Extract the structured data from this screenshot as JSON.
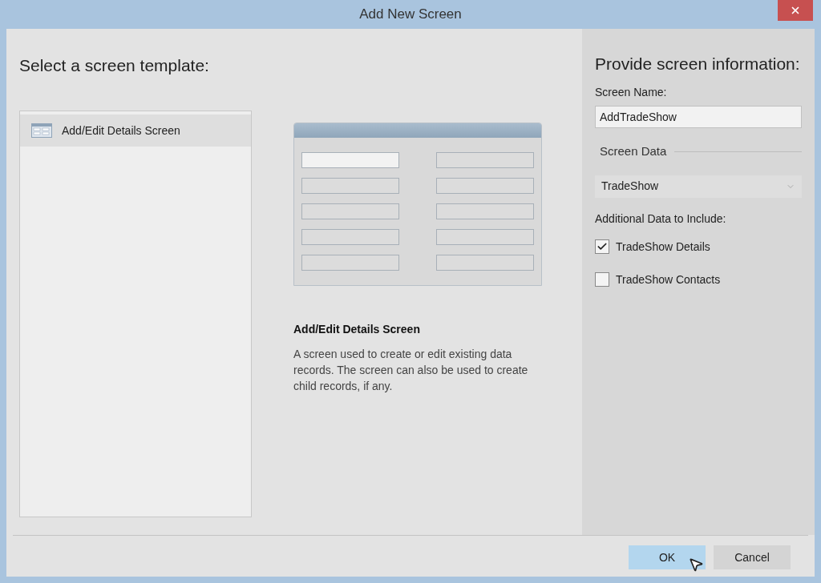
{
  "window": {
    "title": "Add New Screen"
  },
  "templates": {
    "heading": "Select a screen template:",
    "items": [
      {
        "label": "Add/Edit Details Screen",
        "selected": true
      }
    ]
  },
  "preview": {
    "title": "Add/Edit Details Screen",
    "description": "A screen used to create or edit existing data records. The screen can also be used to create child records, if any."
  },
  "info": {
    "heading": "Provide screen information:",
    "screen_name_label": "Screen Name:",
    "screen_name_value": "AddTradeShow",
    "screen_data_label": "Screen Data",
    "screen_data_value": "TradeShow",
    "additional_label": "Additional Data to Include:",
    "options": [
      {
        "label": "TradeShow Details",
        "checked": true
      },
      {
        "label": "TradeShow Contacts",
        "checked": false
      }
    ]
  },
  "buttons": [
    {
      "label": "OK",
      "default": true
    },
    {
      "label": "Cancel",
      "default": false
    }
  ]
}
